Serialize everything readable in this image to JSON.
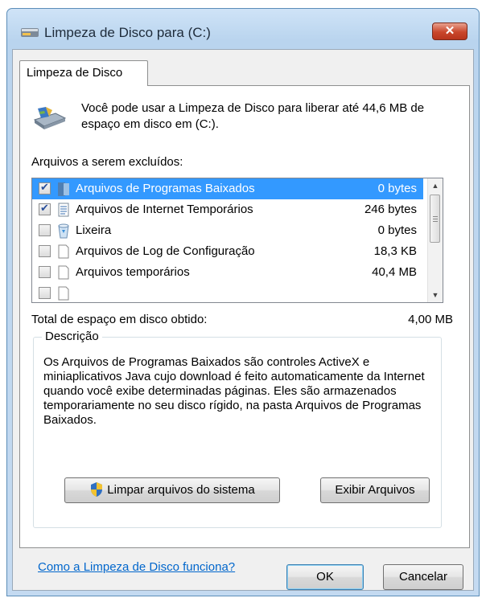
{
  "window": {
    "title": "Limpeza de Disco para  (C:)",
    "close_label": "✕"
  },
  "tab": {
    "label": "Limpeza de Disco"
  },
  "intro": {
    "text": "Você pode usar a Limpeza de Disco para liberar até 44,6 MB de espaço em disco em  (C:)."
  },
  "files": {
    "label": "Arquivos a serem excluídos:",
    "items": [
      {
        "name": "Arquivos de Programas Baixados",
        "size": "0 bytes",
        "checked": true,
        "selected": true,
        "icon": "folder-icon"
      },
      {
        "name": "Arquivos de Internet Temporários",
        "size": "246 bytes",
        "checked": true,
        "selected": false,
        "icon": "document-icon"
      },
      {
        "name": "Lixeira",
        "size": "0 bytes",
        "checked": false,
        "selected": false,
        "icon": "recycle-bin-icon"
      },
      {
        "name": "Arquivos de Log de Configuração",
        "size": "18,3 KB",
        "checked": false,
        "selected": false,
        "icon": "blank-file-icon"
      },
      {
        "name": "Arquivos temporários",
        "size": "40,4 MB",
        "checked": false,
        "selected": false,
        "icon": "blank-file-icon"
      }
    ]
  },
  "total": {
    "label": "Total de espaço em disco obtido:",
    "value": "4,00 MB"
  },
  "description": {
    "legend": "Descrição",
    "text": "Os Arquivos de Programas Baixados são controles ActiveX e miniaplicativos Java cujo download é feito automaticamente da Internet quando você exibe determinadas páginas. Eles são armazenados temporariamente no seu disco rígido, na pasta Arquivos de Programas Baixados."
  },
  "buttons": {
    "clean_system": "Limpar arquivos do sistema",
    "view_files": "Exibir Arquivos",
    "ok": "OK",
    "cancel": "Cancelar"
  },
  "help_link": "Como a Limpeza de Disco funciona?",
  "colors": {
    "selection": "#3399ff",
    "link": "#0066cc",
    "close_button": "#c9462b"
  }
}
